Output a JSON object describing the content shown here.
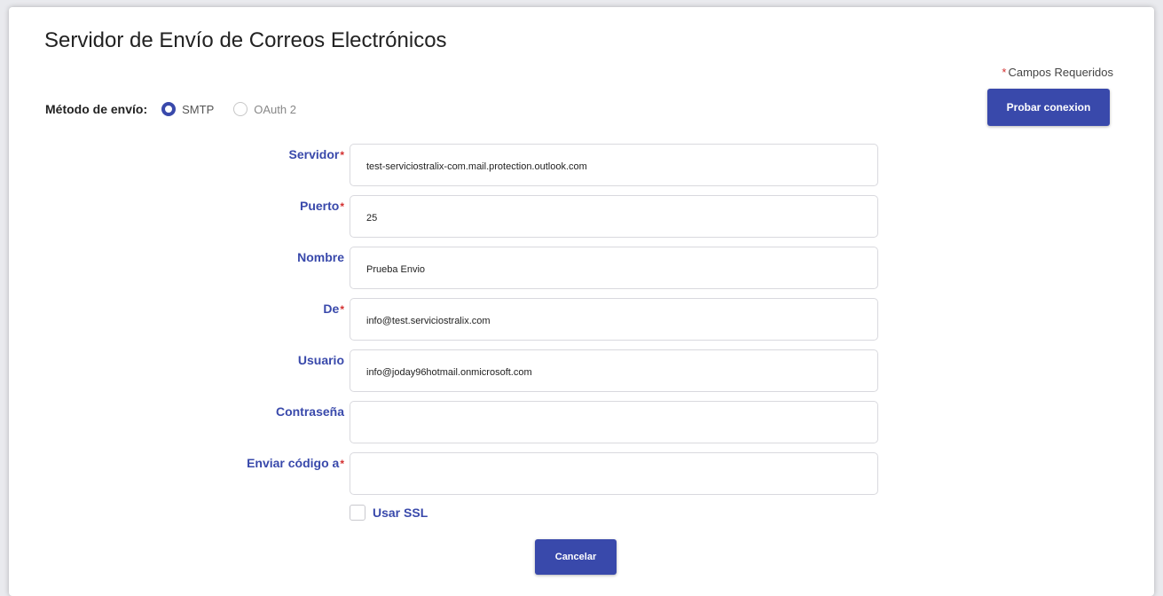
{
  "page": {
    "title": "Servidor de Envío de Correos Electrónicos",
    "required_note": "Campos Requeridos",
    "required_star": "*"
  },
  "method": {
    "label": "Método de envío:",
    "options": [
      {
        "label": "SMTP",
        "checked": true
      },
      {
        "label": "OAuth 2",
        "checked": false
      }
    ]
  },
  "actions": {
    "test_connection": "Probar conexion",
    "cancel": "Cancelar"
  },
  "fields": [
    {
      "label": "Servidor",
      "required": true,
      "value": "test-serviciostralix-com.mail.protection.outlook.com"
    },
    {
      "label": "Puerto",
      "required": true,
      "value": "25"
    },
    {
      "label": "Nombre",
      "required": false,
      "value": "Prueba Envio"
    },
    {
      "label": "De",
      "required": true,
      "value": "info@test.serviciostralix.com"
    },
    {
      "label": "Usuario",
      "required": false,
      "value": "info@joday96hotmail.onmicrosoft.com"
    },
    {
      "label": "Contraseña",
      "required": false,
      "value": ""
    },
    {
      "label": "Enviar código a",
      "required": true,
      "value": ""
    }
  ],
  "ssl": {
    "label": "Usar SSL",
    "checked": false
  },
  "colors": {
    "accent": "#3949ab",
    "required": "#d32f2f",
    "input_border": "#d9d9de"
  }
}
